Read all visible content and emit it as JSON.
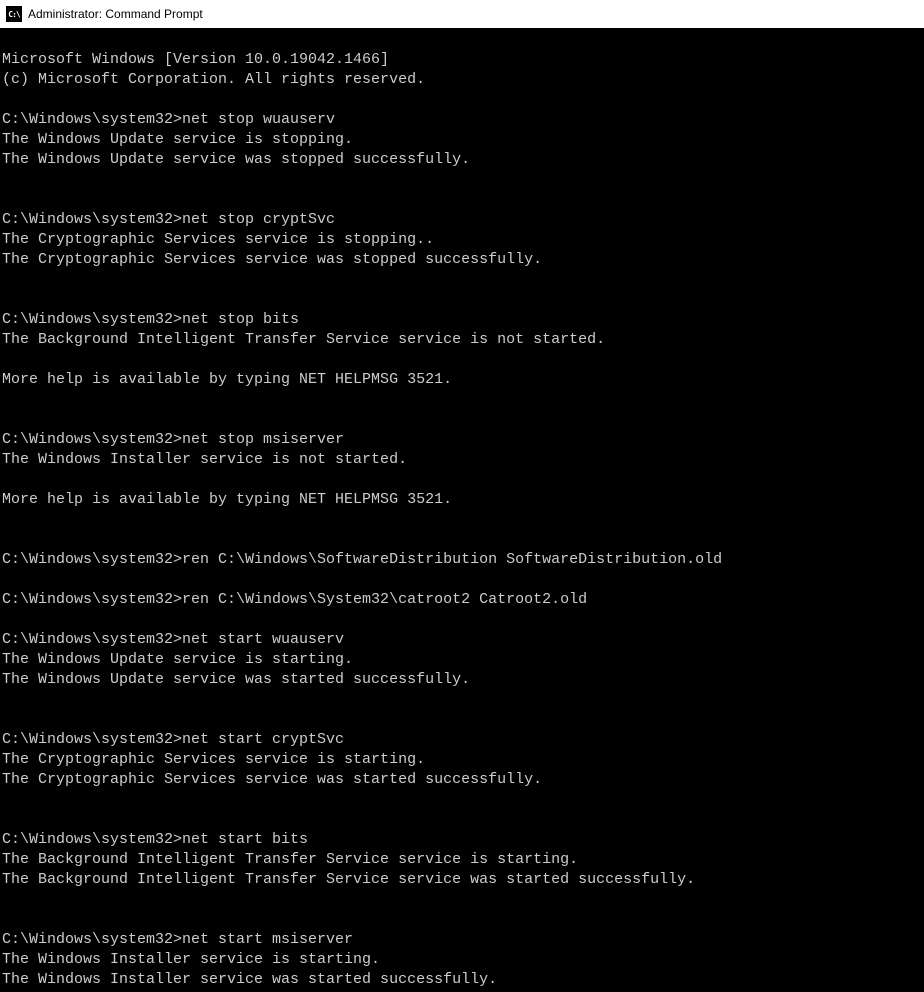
{
  "titlebar": {
    "icon_text": "C:\\",
    "title": "Administrator: Command Prompt"
  },
  "terminal": {
    "lines": [
      "Microsoft Windows [Version 10.0.19042.1466]",
      "(c) Microsoft Corporation. All rights reserved.",
      "",
      "C:\\Windows\\system32>net stop wuauserv",
      "The Windows Update service is stopping.",
      "The Windows Update service was stopped successfully.",
      "",
      "",
      "C:\\Windows\\system32>net stop cryptSvc",
      "The Cryptographic Services service is stopping..",
      "The Cryptographic Services service was stopped successfully.",
      "",
      "",
      "C:\\Windows\\system32>net stop bits",
      "The Background Intelligent Transfer Service service is not started.",
      "",
      "More help is available by typing NET HELPMSG 3521.",
      "",
      "",
      "C:\\Windows\\system32>net stop msiserver",
      "The Windows Installer service is not started.",
      "",
      "More help is available by typing NET HELPMSG 3521.",
      "",
      "",
      "C:\\Windows\\system32>ren C:\\Windows\\SoftwareDistribution SoftwareDistribution.old",
      "",
      "C:\\Windows\\system32>ren C:\\Windows\\System32\\catroot2 Catroot2.old",
      "",
      "C:\\Windows\\system32>net start wuauserv",
      "The Windows Update service is starting.",
      "The Windows Update service was started successfully.",
      "",
      "",
      "C:\\Windows\\system32>net start cryptSvc",
      "The Cryptographic Services service is starting.",
      "The Cryptographic Services service was started successfully.",
      "",
      "",
      "C:\\Windows\\system32>net start bits",
      "The Background Intelligent Transfer Service service is starting.",
      "The Background Intelligent Transfer Service service was started successfully.",
      "",
      "",
      "C:\\Windows\\system32>net start msiserver",
      "The Windows Installer service is starting.",
      "The Windows Installer service was started successfully."
    ]
  }
}
